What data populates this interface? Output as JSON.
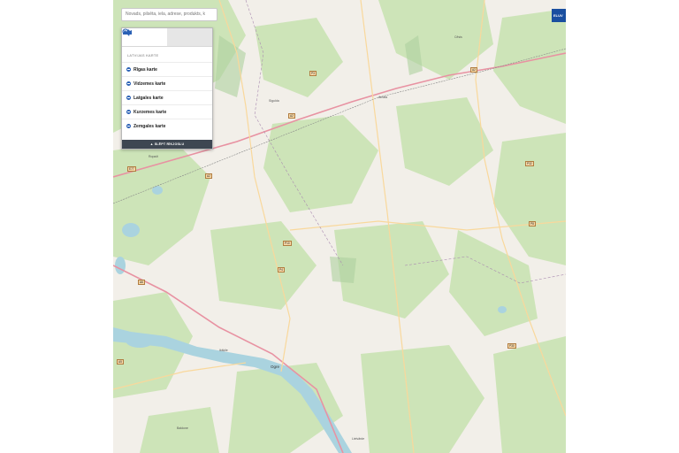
{
  "search": {
    "placeholder": "Novads, pilsēta, iela, adrese, produkts, k"
  },
  "panel": {
    "tabs": [
      {
        "name": "map-layers",
        "icon": "map-layers-icon",
        "active": true
      },
      {
        "name": "zoom",
        "icon": "zoom-in-icon",
        "active": false
      }
    ],
    "section_title": "LATVIJAS KARTE",
    "items": [
      {
        "label": "Rīgas karte"
      },
      {
        "label": "Vidzemes karte"
      },
      {
        "label": "Latgales karte"
      },
      {
        "label": "Kurzemes karte"
      },
      {
        "label": "Zemgales karte"
      }
    ],
    "hide_label": "▲ SLĒPT RĪKJOSLU"
  },
  "corner_button": {
    "label": "ELUV"
  },
  "map": {
    "places": [
      "Sigulda",
      "Ogre",
      "Ikšķile",
      "Baldone",
      "Lielvārde",
      "Ropaži",
      "Amata",
      "Cēsis"
    ],
    "road_shields": [
      "A2",
      "A2",
      "A2",
      "A6",
      "P3",
      "P4",
      "P8",
      "P10",
      "P30",
      "P32",
      "A5",
      "E77"
    ]
  },
  "colors": {
    "forest": "#cde4b8",
    "land": "#f2efe9",
    "water": "#aad3df",
    "road_major": "#e892a2",
    "road_minor": "#f9d89c",
    "accent": "#2b61b5"
  }
}
